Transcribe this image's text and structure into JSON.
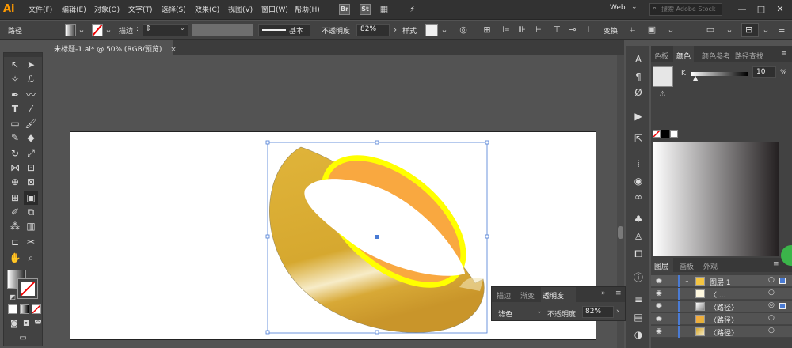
{
  "app": {
    "logo": "Ai"
  },
  "menu": [
    "文件(F)",
    "编辑(E)",
    "对象(O)",
    "文字(T)",
    "选择(S)",
    "效果(C)",
    "视图(V)",
    "窗口(W)",
    "帮助(H)"
  ],
  "bridge_icons": [
    "Br",
    "St"
  ],
  "workspace": "Web",
  "search": {
    "placeholder": "搜索 Adobe Stock"
  },
  "window_buttons": [
    "—",
    "□",
    "✕"
  ],
  "control_bar": {
    "object_type": "路径",
    "stroke_label": "描边",
    "brush_label": "基本",
    "opacity_label": "不透明度",
    "opacity_value": "82%",
    "style_label": "样式",
    "transform_label": "变换"
  },
  "document_tab": {
    "title": "未标题-1.ai* @ 50% (RGB/预览)",
    "close": "×"
  },
  "right_panel": {
    "tabs": [
      "色板",
      "颜色",
      "颜色参考",
      "路径查找"
    ],
    "channel_label": "K",
    "channel_value": "10",
    "channel_unit": "%"
  },
  "layers_panel": {
    "tabs": [
      "图层",
      "画板",
      "外观"
    ],
    "rows": [
      {
        "name": "图层 1"
      },
      {
        "name": "〈 ... "
      },
      {
        "name": "〈路径〉"
      },
      {
        "name": "〈路径〉"
      },
      {
        "name": "〈路径〉"
      }
    ]
  },
  "transparency_panel": {
    "tabs": [
      "描边",
      "渐变",
      "透明度"
    ],
    "blend_mode": "滤色",
    "opacity_label": "不透明度",
    "opacity_value": "82%"
  },
  "colors": {
    "accent": "#ff9a00",
    "ring_inner": "#f9a840",
    "ring_outer": "#d9a531",
    "highlight": "#ffff00"
  }
}
